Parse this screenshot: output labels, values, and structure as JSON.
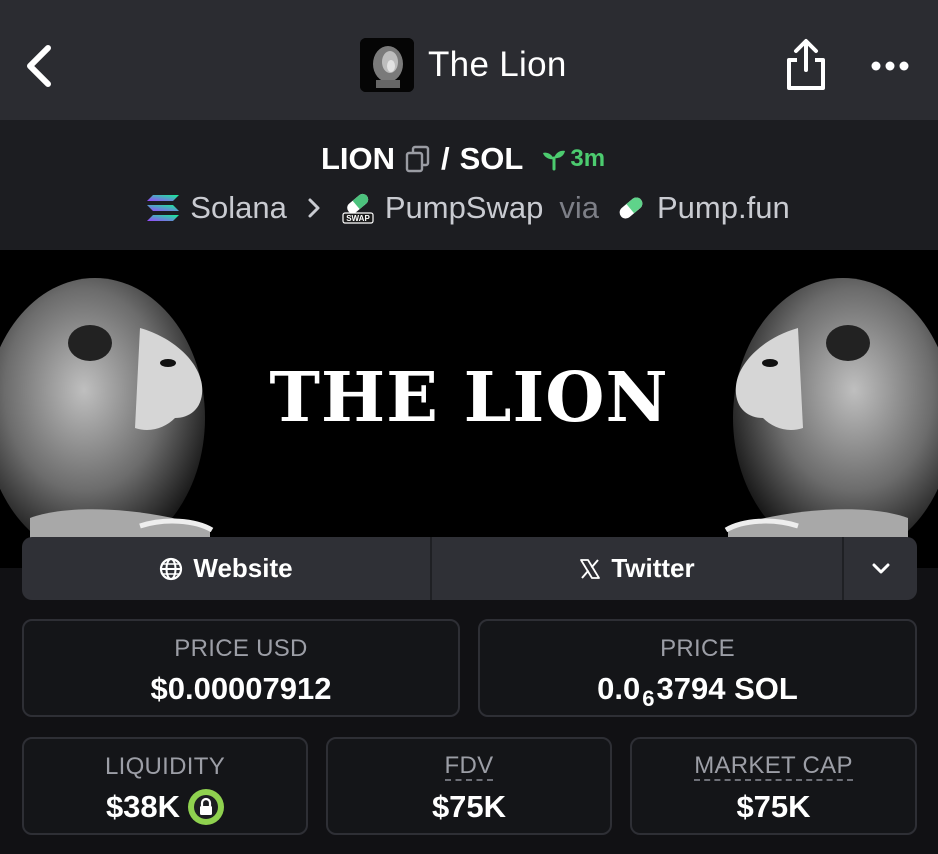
{
  "header": {
    "title": "The Lion",
    "icons": {
      "back": "chevron-left-icon",
      "share": "share-icon",
      "more": "more-dots-icon",
      "avatar": "lion-avatar"
    }
  },
  "pair": {
    "token": "LION",
    "separator": "/",
    "quote": "SOL",
    "age": "3m",
    "age_icon": "sprout-icon",
    "chain": "Solana",
    "dex": "PumpSwap",
    "via": "via",
    "launchpad": "Pump.fun"
  },
  "banner": {
    "title": "THE LION"
  },
  "links": {
    "website": "Website",
    "twitter": "Twitter"
  },
  "stats": {
    "price_usd_label": "PRICE USD",
    "price_usd": "$0.00007912",
    "price_label": "PRICE",
    "price_prefix": "0.0",
    "price_zeros": "6",
    "price_rest": "3794 SOL",
    "liquidity_label": "LIQUIDITY",
    "liquidity": "$38K",
    "fdv_label": "FDV",
    "fdv": "$75K",
    "mcap_label": "MARKET CAP",
    "mcap": "$75K"
  },
  "colors": {
    "topbar": "#2b2c31",
    "pairbar": "#1c1d21",
    "accent_green": "#4ccb6f",
    "lock_green": "#8fd14f",
    "card_border": "#2e2f35"
  }
}
